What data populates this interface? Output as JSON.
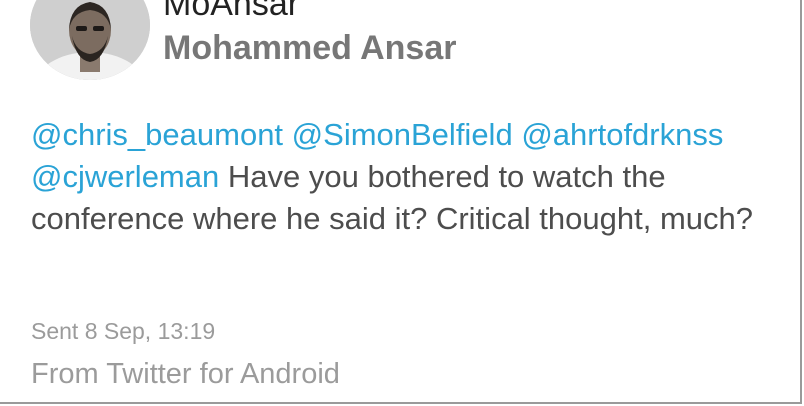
{
  "profile": {
    "display_name": "MoAnsar",
    "full_name": "Mohammed Ansar",
    "avatar_icon": "profile-photo"
  },
  "tweet": {
    "mentions": [
      "@chris_beaumont",
      "@SimonBelfield",
      "@ahrtofdrknss",
      "@cjwerleman"
    ],
    "text": "Have you bothered to watch the conference where he said it? Critical thought, much?"
  },
  "meta": {
    "sent": "Sent 8 Sep, 13:19",
    "source": "From Twitter for Android"
  },
  "colors": {
    "mention": "#2aa3d6",
    "body_text": "#4d4d4d",
    "secondary_text": "#9b9b9b"
  }
}
